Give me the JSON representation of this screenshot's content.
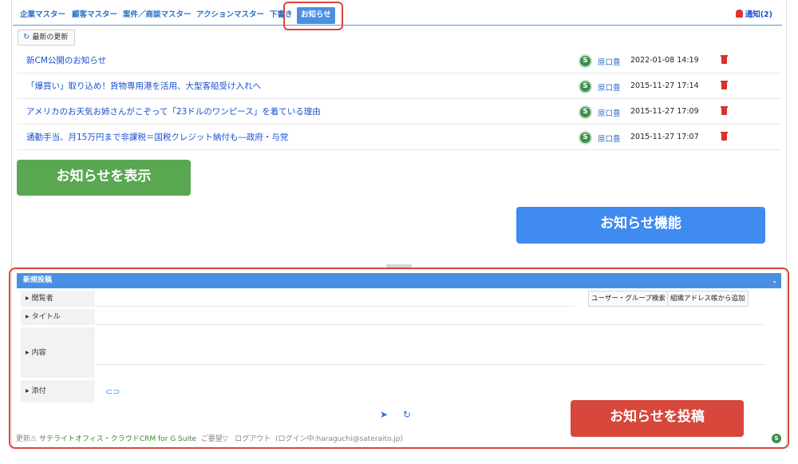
{
  "tabs": [
    {
      "label": "企業マスター"
    },
    {
      "label": "顧客マスター"
    },
    {
      "label": "案件／商談マスター"
    },
    {
      "label": "アクションマスター"
    },
    {
      "label": "下書き"
    },
    {
      "label": "お知らせ",
      "active": true
    }
  ],
  "notification": {
    "label": "通知(2)"
  },
  "toolbar": {
    "refresh_label": "最新の更新"
  },
  "news": [
    {
      "title": "新CM公開のお知らせ",
      "author": "原口豊",
      "date": "2022-01-08 14:19"
    },
    {
      "title": "「爆買い」取り込め！貨物専用港を活用、大型客船受け入れへ",
      "author": "原口豊",
      "date": "2015-11-27 17:14"
    },
    {
      "title": "アメリカのお天気お姉さんがこぞって「23ドルのワンピース」を着ている理由",
      "author": "原口豊",
      "date": "2015-11-27 17:09"
    },
    {
      "title": "通勤手当、月15万円まで非課税＝国税クレジット納付も―政府・与党",
      "author": "原口豊",
      "date": "2015-11-27 17:07"
    }
  ],
  "callouts": {
    "show": "お知らせを表示",
    "feature": "お知らせ機能",
    "post": "お知らせを投稿"
  },
  "form": {
    "header": "新規投稿",
    "viewers_label": "閲覧者",
    "title_label": "タイトル",
    "body_label": "内容",
    "attach_label": "添付",
    "user_group_search": "ユーザー・グループ検索",
    "add_from_directory": "組織アドレス帳から追加"
  },
  "footer": {
    "update": "更新",
    "product": "サテライトオフィス・クラウドCRM for G Suite",
    "feedback": "ご要望▽",
    "logout": "ログアウト",
    "login_info": "(ログイン中:haraguchi@sateraito.jp)"
  },
  "colors": {
    "tab_text": "#2a6fc9",
    "active_tab": "#4a90e2",
    "link": "#1a4fd0",
    "highlight_border": "#d9453a",
    "callout_green": "#5aa752",
    "callout_blue": "#3f8bef",
    "callout_red": "#d7473c"
  }
}
